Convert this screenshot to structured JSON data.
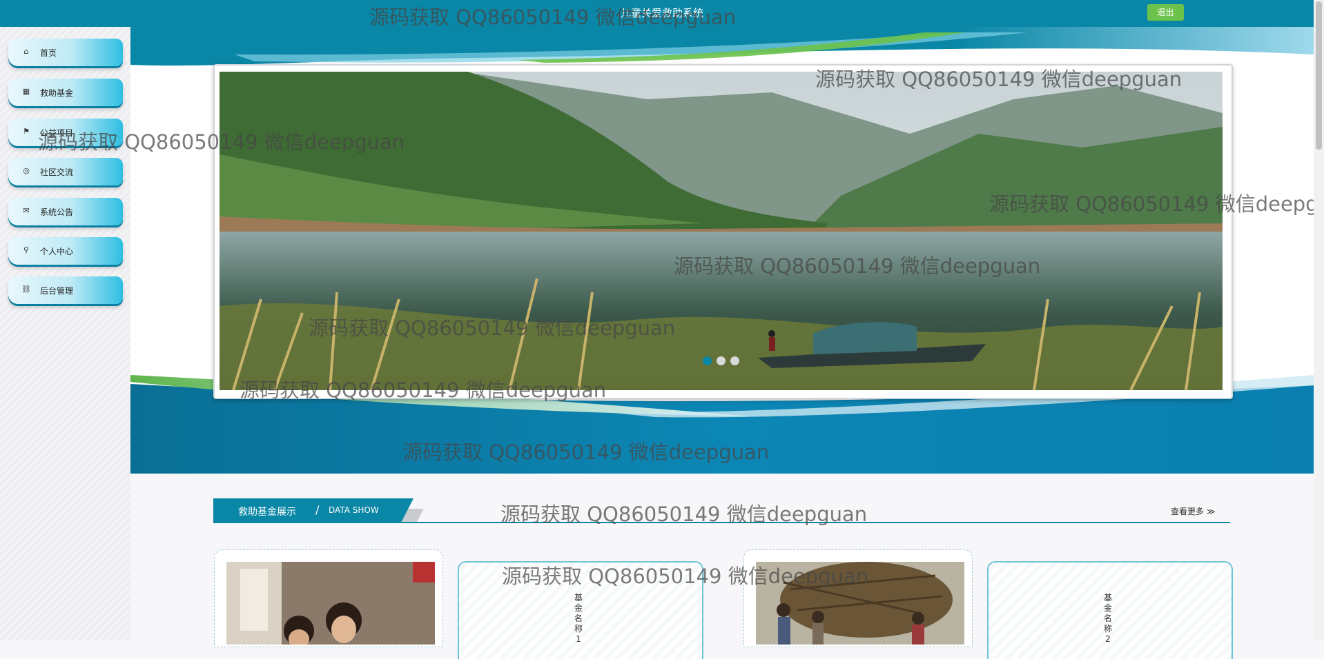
{
  "app_title": "儿童关爱救助系统",
  "header": {
    "logout_label": "退出"
  },
  "sidebar": {
    "items": [
      {
        "label": "首页",
        "icon": "home-icon",
        "glyph": "⌂"
      },
      {
        "label": "救助基金",
        "icon": "calendar-icon",
        "glyph": "▦"
      },
      {
        "label": "公益项目",
        "icon": "flag-icon",
        "glyph": "⚑"
      },
      {
        "label": "社区交流",
        "icon": "globe-icon",
        "glyph": "◎"
      },
      {
        "label": "系统公告",
        "icon": "mail-icon",
        "glyph": "✉"
      },
      {
        "label": "个人中心",
        "icon": "user-icon",
        "glyph": "⚲"
      },
      {
        "label": "后台管理",
        "icon": "link-icon",
        "glyph": "⛓"
      }
    ]
  },
  "carousel": {
    "slide_count": 3,
    "active_index": 0
  },
  "section": {
    "title_cn": "救助基金展示",
    "separator": "/",
    "title_en": "DATA SHOW",
    "more_label": "查看更多 ≫"
  },
  "cards": [
    {
      "type": "image"
    },
    {
      "type": "text",
      "label": "基金名称1"
    },
    {
      "type": "image"
    },
    {
      "type": "text",
      "label": "基金名称2"
    }
  ],
  "watermark_text": "源码获取 QQ86050149 微信deepguan",
  "colors": {
    "brand": "#0a87a6",
    "accent_green": "#6cc24a",
    "sky": "#2dbfe2"
  }
}
